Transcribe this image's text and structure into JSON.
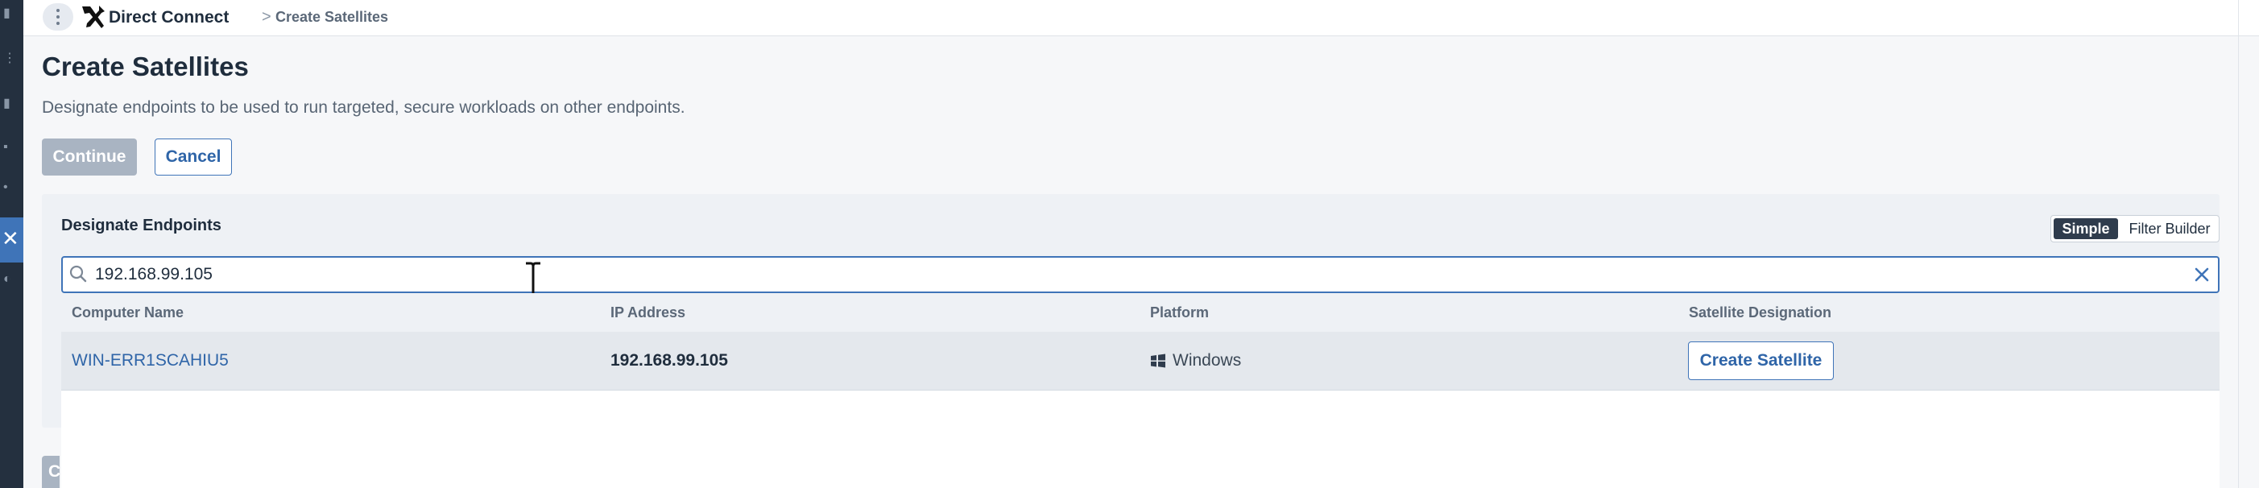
{
  "breadcrumb": {
    "app_name": "Direct Connect",
    "separator": ">",
    "current": "Create Satellites"
  },
  "header": {
    "title": "Create Satellites",
    "description": "Designate endpoints to be used to run targeted, secure workloads on other endpoints.",
    "continue_label": "Continue",
    "cancel_label": "Cancel"
  },
  "panel": {
    "title": "Designate Endpoints",
    "toggle": {
      "simple": "Simple",
      "filter_builder": "Filter Builder",
      "selected": "Simple"
    }
  },
  "search": {
    "value": "192.168.99.105"
  },
  "table": {
    "columns": [
      "Computer Name",
      "IP Address",
      "Platform",
      "Satellite Designation"
    ],
    "rows": [
      {
        "computer_name": "WIN-ERR1SCAHIU5",
        "ip_address": "192.168.99.105",
        "platform": "Windows",
        "action": "Create Satellite"
      }
    ]
  },
  "partial_button_label": "C",
  "colors": {
    "accent": "#3f74b8",
    "rail": "#24303f",
    "disabled_button": "#a9b4c2"
  },
  "icons": [
    "menu-dots-icon",
    "direct-connect-icon",
    "search-icon",
    "clear-icon",
    "windows-icon",
    "text-cursor-icon"
  ]
}
